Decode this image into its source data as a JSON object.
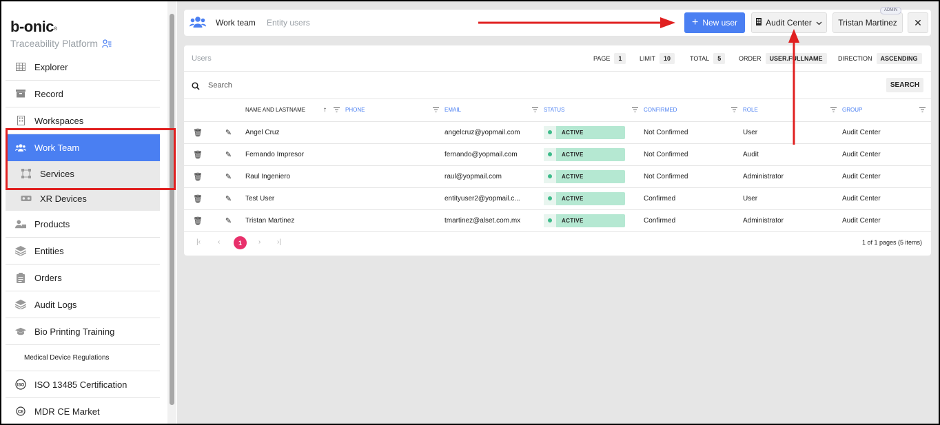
{
  "sidebar": {
    "brand": "b-onic",
    "brand_mark": "®",
    "subtitle": "Traceability Platform",
    "items": [
      {
        "label": "Explorer",
        "icon": "grid-icon"
      },
      {
        "label": "Record",
        "icon": "archive-icon"
      },
      {
        "label": "Workspaces",
        "icon": "building-icon"
      },
      {
        "label": "Work Team",
        "icon": "team-icon"
      },
      {
        "label": "Services",
        "icon": "services-icon"
      },
      {
        "label": "XR Devices",
        "icon": "vr-headset-icon"
      },
      {
        "label": "Products",
        "icon": "person-box-icon"
      },
      {
        "label": "Entities",
        "icon": "layers-icon"
      },
      {
        "label": "Orders",
        "icon": "clipboard-icon"
      },
      {
        "label": "Audit Logs",
        "icon": "stack-icon"
      },
      {
        "label": "Bio Printing Training",
        "icon": "graduation-cap-icon"
      }
    ],
    "section": "Medical Device Regulations",
    "regulation_items": [
      {
        "label": "ISO 13485 Certification",
        "icon": "iso-icon"
      },
      {
        "label": "MDR CE Market",
        "icon": "ce-icon"
      }
    ]
  },
  "topbar": {
    "tab_active": "Work team",
    "tab_inactive": "Entity users",
    "new_user": "New user",
    "audit_center": "Audit Center",
    "user_name": "Tristan Martinez",
    "admin_badge": "ADMIN",
    "close": "✕"
  },
  "users": {
    "title": "Users",
    "page_label": "PAGE",
    "page": "1",
    "limit_label": "LIMIT",
    "limit": "10",
    "total_label": "TOTAL",
    "total": "5",
    "order_label": "ORDER",
    "order": "USER.FULLNAME",
    "direction_label": "DIRECTION",
    "direction": "ASCENDING",
    "search_placeholder": "Search",
    "search_button": "SEARCH",
    "columns": [
      "NAME AND LASTNAME",
      "PHONE",
      "EMAIL",
      "STATUS",
      "CONFIRMED",
      "ROLE",
      "GROUP"
    ],
    "rows": [
      {
        "name": "Angel Cruz",
        "phone": "",
        "email": "angelcruz@yopmail.com",
        "status": "ACTIVE",
        "confirmed": "Not Confirmed",
        "role": "User",
        "group": "Audit Center"
      },
      {
        "name": "Fernando Impresor",
        "phone": "",
        "email": "fernando@yopmail.com",
        "status": "ACTIVE",
        "confirmed": "Not Confirmed",
        "role": "Audit",
        "group": "Audit Center"
      },
      {
        "name": "Raul Ingeniero",
        "phone": "",
        "email": "raul@yopmail.com",
        "status": "ACTIVE",
        "confirmed": "Not Confirmed",
        "role": "Administrator",
        "group": "Audit Center"
      },
      {
        "name": "Test User",
        "phone": "",
        "email": "entityuser2@yopmail.c...",
        "status": "ACTIVE",
        "confirmed": "Confirmed",
        "role": "User",
        "group": "Audit Center"
      },
      {
        "name": "Tristan Martinez",
        "phone": "",
        "email": "tmartinez@alset.com.mx",
        "status": "ACTIVE",
        "confirmed": "Confirmed",
        "role": "Administrator",
        "group": "Audit Center"
      }
    ],
    "pager": {
      "current": "1",
      "info": "1 of 1 pages (5 items)"
    }
  },
  "colors": {
    "accent": "#4a7ff2",
    "active_status": "#b5e8d2",
    "current_page": "#e8306b",
    "annotation": "#e02020"
  }
}
